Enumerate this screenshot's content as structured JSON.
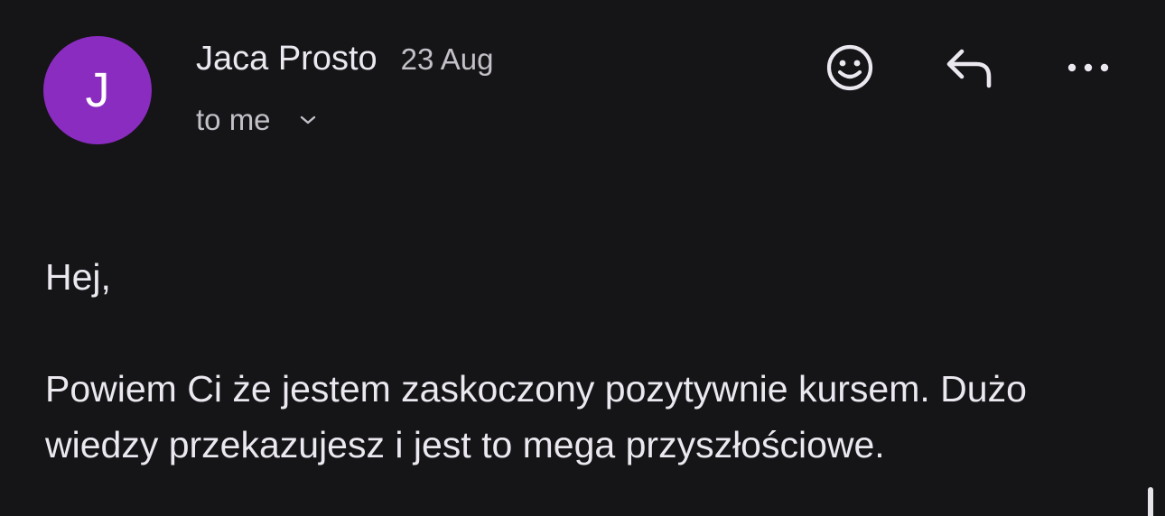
{
  "message": {
    "sender": {
      "initial": "J",
      "name": "Jaca Prosto",
      "avatar_color": "#8a2cc0"
    },
    "date": "23 Aug",
    "recipient": "to me",
    "actions": {
      "react_icon": "smiley-face-icon",
      "reply_icon": "reply-arrow-icon",
      "more_icon": "more-horizontal-icon"
    },
    "body": {
      "greeting": "Hej,",
      "paragraph": "Powiem Ci że jestem zaskoczony pozytywnie kursem. Dużo wiedzy przekazujesz i jest to mega przyszłościowe."
    }
  },
  "colors": {
    "background": "#151417",
    "text_primary": "#ebe9ef",
    "text_secondary": "#c3c1c7"
  }
}
